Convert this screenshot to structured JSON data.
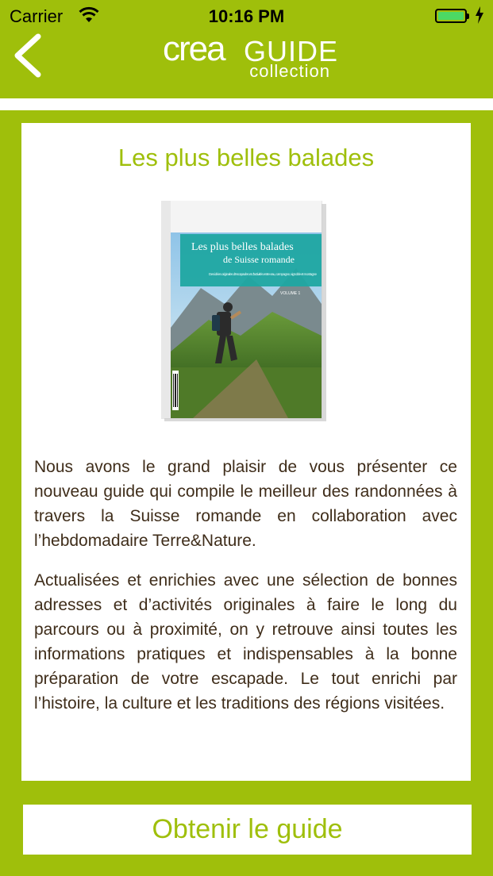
{
  "status_bar": {
    "carrier": "Carrier",
    "time": "10:16 PM",
    "battery_color": "#4cd964"
  },
  "nav": {
    "back_icon": "chevron-left-icon",
    "logo": {
      "crea": "crea",
      "guide": "GUIDE",
      "collection": "collection"
    }
  },
  "colors": {
    "accent": "#9fbf0b",
    "text": "#3f2d1a",
    "background_card": "#ffffff"
  },
  "card": {
    "title": "Les plus belles balades",
    "cover": {
      "title": "Les plus belles balades",
      "subtitle": "de Suisse romande",
      "blurb": "Des idées originales d'escapades et d'activités entre eau, campagne, vignoble et montagne",
      "volume": "VOLUME 1"
    },
    "paragraphs": [
      "Nous avons le grand plaisir de vous présenter ce nouveau guide qui compile le meilleur des randonnées à travers la Suisse romande en collaboration avec l’hebdomadaire Terre&Nature.",
      "Actualisées et enrichies avec une sélection de bonnes adresses et d’activités originales à faire le long du parcours ou à proximité, on y retrouve ainsi toutes les informations pratiques et indispensables à la bonne préparation de votre escapade. Le tout enrichi par l’histoire, la culture et les traditions des régions visitées."
    ]
  },
  "cta": {
    "label": "Obtenir le guide"
  }
}
